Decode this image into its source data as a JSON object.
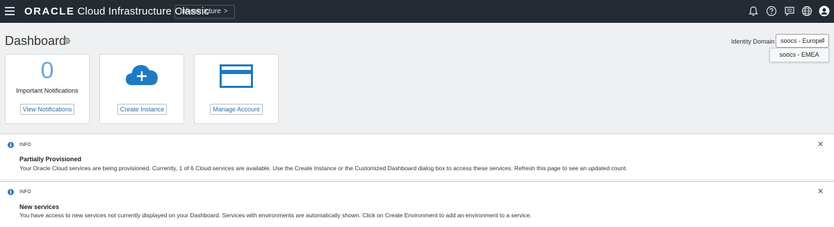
{
  "topbar": {
    "brand_strong": "ORACLE",
    "brand_rest": "Cloud Infrastructure Classic",
    "breadcrumb": "Infrastructure",
    "breadcrumb_chevron": ">",
    "icons": [
      "bell-icon",
      "help-icon",
      "chat-icon",
      "globe-icon",
      "user-avatar-icon"
    ]
  },
  "header": {
    "title": "Dashboard",
    "identity_domain_label": "Identity Domain",
    "identity_domain_value": "soocs - Europe",
    "identity_domain_option": "soocs - EMEA"
  },
  "tiles": [
    {
      "count": "0",
      "label": "Important Notifications",
      "button": "View Notifications"
    },
    {
      "icon": "cloud-plus-icon",
      "button": "Create Instance"
    },
    {
      "icon": "credit-card-icon",
      "button": "Manage Account"
    }
  ],
  "notices": [
    {
      "kind": "INFO",
      "title": "Partially Provisioned",
      "message": "Your Oracle Cloud services are being provisioned. Currently, 1 of 6 Cloud services are available. Use the Create Instance or the Customized Dashboard dialog box to access these services. Refresh this page to see an updated count."
    },
    {
      "kind": "INFO",
      "title": "New services",
      "message": "You have access to new services not currently displayed on your Dashboard. Services with environments are automatically shown. Click on Create Environment to add an environment to a service."
    }
  ],
  "colors": {
    "topbar_bg": "#252b33",
    "page_bg": "#eef0f2",
    "accent_blue": "#1f7ac2",
    "link_blue": "#2d6ea8",
    "info_blue": "#2f78c4"
  }
}
